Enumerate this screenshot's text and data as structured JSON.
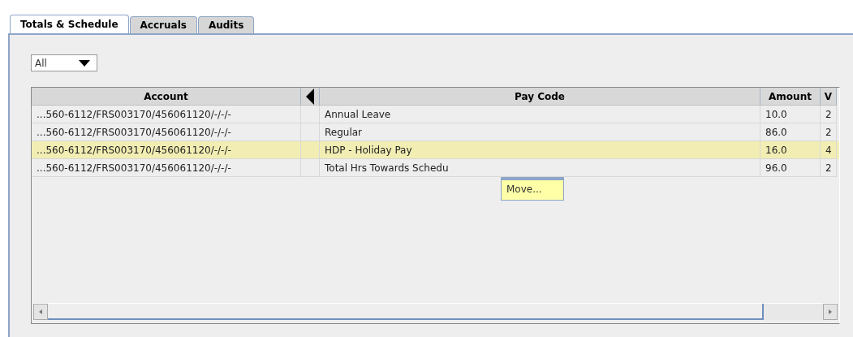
{
  "tabs": [
    {
      "label": "Totals & Schedule",
      "selected": true
    },
    {
      "label": "Accruals",
      "selected": false
    },
    {
      "label": "Audits",
      "selected": false
    }
  ],
  "filter": {
    "value": "All"
  },
  "table": {
    "columns": [
      "Account",
      "Pay Code",
      "Amount",
      "V"
    ],
    "rows": [
      {
        "cells": [
          "...560-6112/FRS003170/456061120/-/-/-",
          "Annual Leave",
          "10.0",
          "2"
        ],
        "selected": false
      },
      {
        "cells": [
          "...560-6112/FRS003170/456061120/-/-/-",
          "Regular",
          "86.0",
          "2"
        ],
        "selected": false
      },
      {
        "cells": [
          "...560-6112/FRS003170/456061120/-/-/-",
          "HDP - Holiday Pay",
          "16.0",
          "4"
        ],
        "selected": true
      },
      {
        "cells": [
          "...560-6112/FRS003170/456061120/-/-/-",
          "Total Hrs Towards Schedu",
          "96.0",
          "2"
        ],
        "selected": false
      }
    ]
  },
  "context_menu": {
    "items": [
      "Move..."
    ]
  }
}
